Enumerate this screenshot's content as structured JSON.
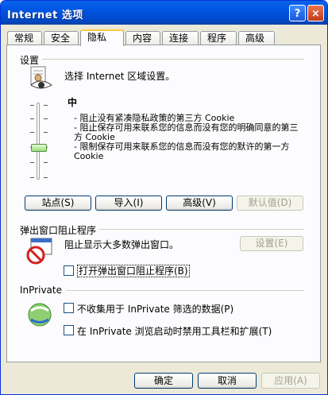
{
  "window": {
    "title": "Internet 选项",
    "help_label": "?",
    "close_label": "×"
  },
  "tabs": [
    "常规",
    "安全",
    "隐私",
    "内容",
    "连接",
    "程序",
    "高级"
  ],
  "settings": {
    "title": "设置",
    "description": "选择 Internet 区域设置。",
    "level": "中",
    "bullets": [
      "- 阻止没有紧凑隐私政策的第三方 Cookie",
      "- 阻止保存可用来联系您的信息而没有您的明确同意的第三方 Cookie",
      "- 限制保存可用来联系您的信息而没有您的默许的第一方 Cookie"
    ],
    "buttons": {
      "sites": "站点(S)",
      "import": "导入(I)",
      "advanced": "高级(V)",
      "default": "默认值(D)"
    }
  },
  "popup": {
    "title": "弹出窗口阻止程序",
    "description": "阻止显示大多数弹出窗口。",
    "settings_button": "设置(E)",
    "checkbox_label": "打开弹出窗口阻止程序(B)",
    "checked": false
  },
  "inprivate": {
    "title": "InPrivate",
    "checkbox1_label": "不收集用于 InPrivate 筛选的数据(P)",
    "checkbox2_label": "在 InPrivate 浏览启动时禁用工具栏和扩展(T)",
    "checked1": false,
    "checked2": false
  },
  "footer": {
    "ok": "确定",
    "cancel": "取消",
    "apply": "应用(A)"
  }
}
